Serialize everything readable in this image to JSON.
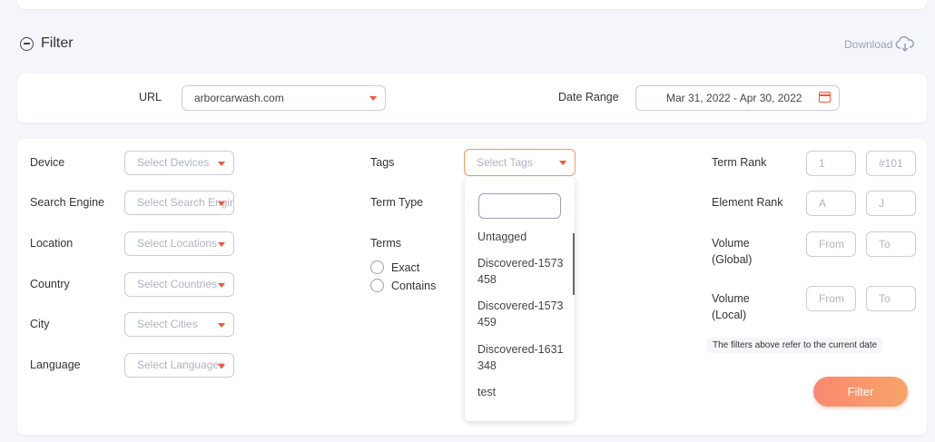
{
  "header": {
    "filter_title": "Filter",
    "download_label": "Download"
  },
  "url_row": {
    "url_label": "URL",
    "url_value": "arborcarwash.com",
    "date_label": "Date Range",
    "date_value": "Mar 31, 2022 - Apr 30, 2022"
  },
  "left_filters": {
    "device_label": "Device",
    "device_placeholder": "Select Devices",
    "engine_label": "Search Engine",
    "engine_placeholder": "Select Search Engines",
    "location_label": "Location",
    "location_placeholder": "Select Locations",
    "country_label": "Country",
    "country_placeholder": "Select Countries",
    "city_label": "City",
    "city_placeholder": "Select Cities",
    "language_label": "Language",
    "language_placeholder": "Select Languages"
  },
  "middle_filters": {
    "tags_label": "Tags",
    "tags_placeholder": "Select Tags",
    "term_type_label": "Term Type",
    "terms_label": "Terms",
    "terms_options": [
      "Exact",
      "Contains"
    ]
  },
  "tags_dropdown": {
    "search_value": "",
    "items": [
      "Untagged",
      "Discovered-1573458",
      "Discovered-1573459",
      "Discovered-1631348",
      "test"
    ]
  },
  "right_filters": {
    "term_rank_label": "Term Rank",
    "term_rank_from": "1",
    "term_rank_to": "#101",
    "element_rank_label": "Element Rank",
    "element_rank_from": "A",
    "element_rank_to": "J",
    "volume_global_label_1": "Volume",
    "volume_global_label_2": "(Global)",
    "volume_global_from": "From",
    "volume_global_to": "To",
    "volume_local_label_1": "Volume",
    "volume_local_label_2": "(Local)",
    "volume_local_from": "From",
    "volume_local_to": "To",
    "note": "The filters above refer to the current date"
  },
  "actions": {
    "filter_button": "Filter"
  },
  "colors": {
    "accent": "#f0573c",
    "button_gradient_start": "#fb8870",
    "button_gradient_end": "#f6a46a",
    "background": "#f5f6fb"
  }
}
